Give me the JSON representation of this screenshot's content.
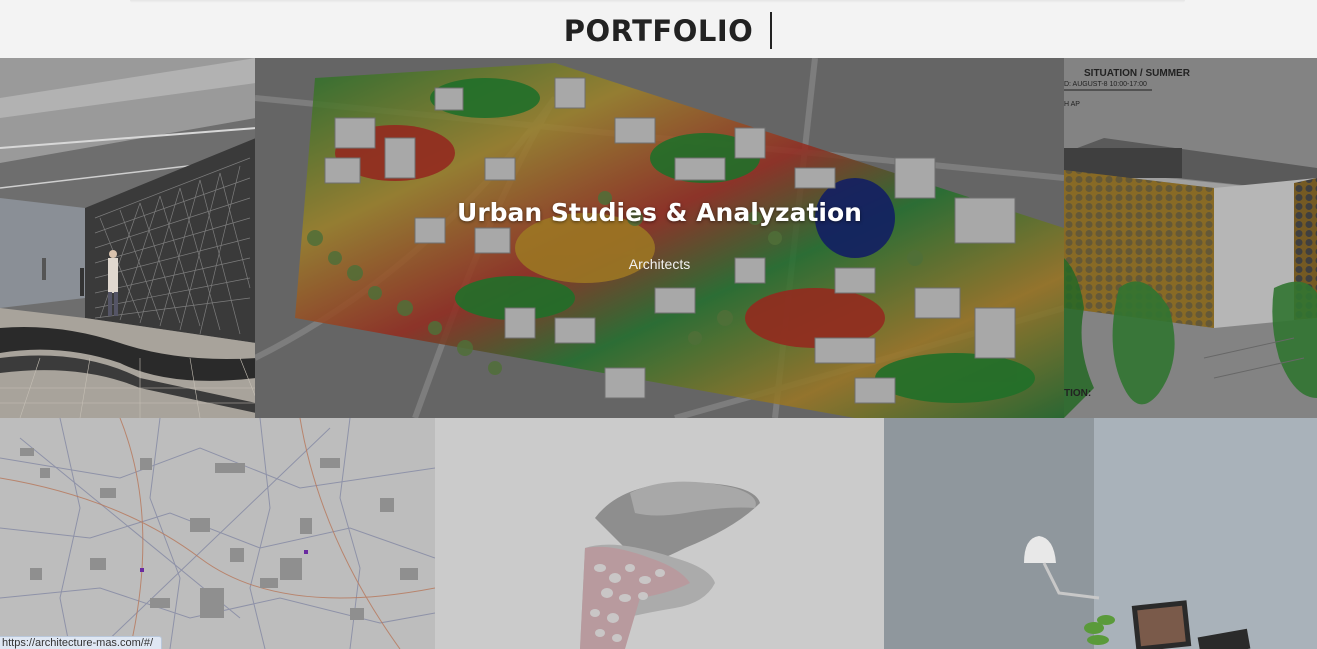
{
  "header": {
    "title": "PORTFOLIO"
  },
  "featured": {
    "title": "Urban Studies & Analyzation",
    "category": "Architects"
  },
  "panel_text": {
    "line1": "SITUATION / SUMMER",
    "line2": "D: AUGUST-8 10:00-17:00",
    "line3": "H AP",
    "line4": "TION:"
  },
  "status_bar": {
    "url": "https://architecture-mas.com/#/"
  },
  "colors": {
    "header_bg": "#f3f3f3",
    "title": "#222222",
    "status_bg": "#dfe7f3"
  }
}
